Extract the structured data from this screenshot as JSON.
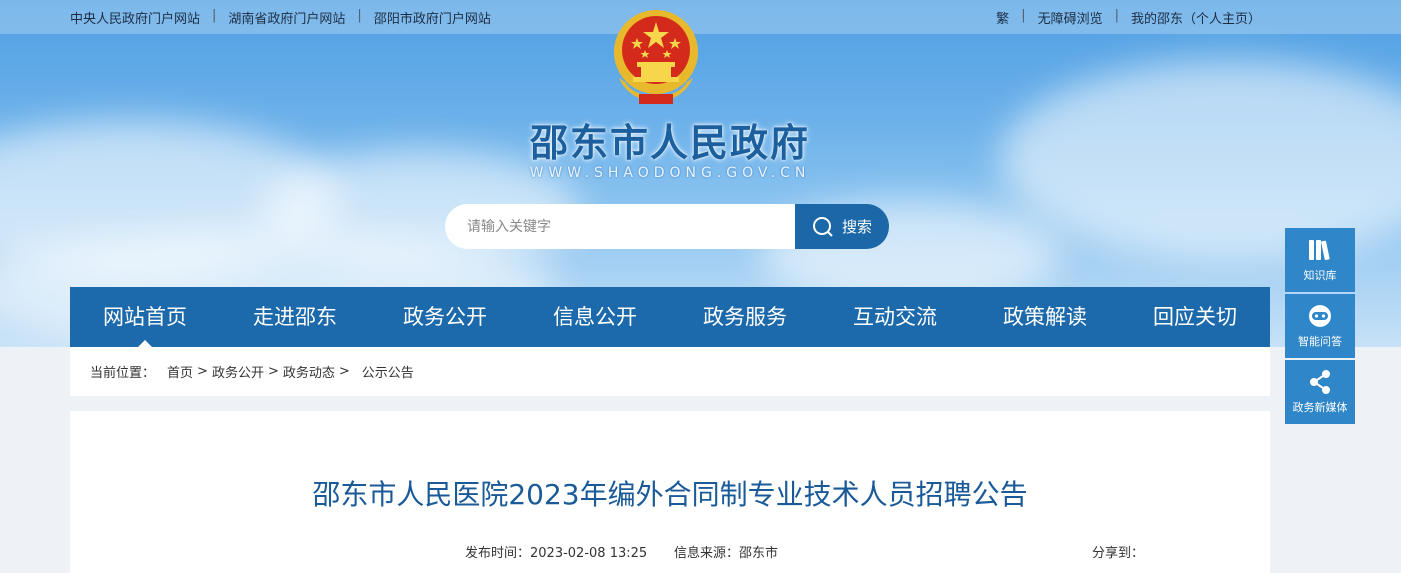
{
  "top_links": {
    "left": [
      "中央人民政府门户网站",
      "湖南省政府门户网站",
      "邵阳市政府门户网站"
    ],
    "right": [
      "繁",
      "无障碍浏览",
      "我的邵东（个人主页）"
    ]
  },
  "site": {
    "title": "邵东市人民政府",
    "url": "WWW.SHAODONG.GOV.CN"
  },
  "search": {
    "placeholder": "请输入关键字",
    "button_label": "搜索"
  },
  "nav": [
    "网站首页",
    "走进邵东",
    "政务公开",
    "信息公开",
    "政务服务",
    "互动交流",
    "政策解读",
    "回应关切"
  ],
  "breadcrumb": {
    "prefix": "当前位置：",
    "items": [
      "首页",
      "政务公开",
      "政务动态",
      "公示公告"
    ]
  },
  "article": {
    "title": "邵东市人民医院2023年编外合同制专业技术人员招聘公告",
    "publish_label": "发布时间：",
    "publish_time": "2023-02-08 13:25",
    "source_label": "信息来源：",
    "source": "邵东市",
    "share_label": "分享到："
  },
  "side": [
    {
      "label": "知识库",
      "icon": "books-icon"
    },
    {
      "label": "智能问答",
      "icon": "robot-icon"
    },
    {
      "label": "政务新媒体",
      "icon": "share-icon"
    }
  ],
  "colors": {
    "nav_bg": "#1c69ab",
    "title_blue": "#1a5a98",
    "side_bg": "#2f86c8"
  }
}
